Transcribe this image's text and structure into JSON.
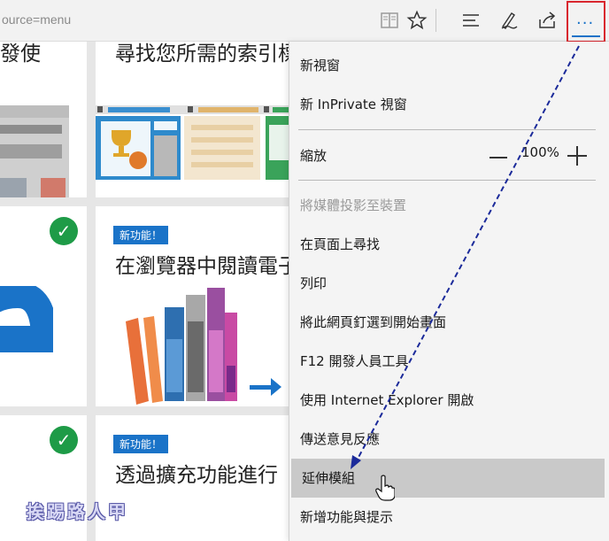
{
  "toolbar": {
    "url_text": "ource=menu",
    "more_dots": "···"
  },
  "page": {
    "card1_title": "發使",
    "card2_title": "尋找您所需的索引標",
    "card3_badge": "新功能！",
    "card3_title": "在瀏覽器中閱讀電子",
    "card4_badge": "新功能！",
    "card4_title": "透過擴充功能進行",
    "watermark": "挨踢路人甲",
    "colors": {
      "accent": "#1a73c8",
      "check": "#1e9b47",
      "highlight_border": "#d9262e"
    }
  },
  "menu": {
    "new_window": "新視窗",
    "new_inprivate": "新 InPrivate 視窗",
    "zoom_label": "縮放",
    "zoom_value": "100%",
    "cast_media": "將媒體投影至裝置",
    "find_on_page": "在頁面上尋找",
    "print": "列印",
    "pin_to_start": "將此網頁釘選到開始畫面",
    "f12_tools": "F12 開發人員工具",
    "open_with_ie": "使用 Internet Explorer 開啟",
    "send_feedback": "傳送意見反應",
    "extensions": "延伸模組",
    "whats_new": "新增功能與提示"
  }
}
